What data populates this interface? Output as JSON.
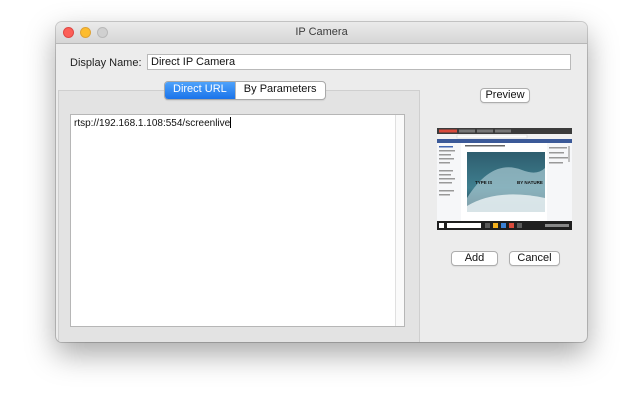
{
  "window": {
    "title": "IP Camera"
  },
  "form": {
    "display_name_label": "Display Name:",
    "display_name_value": "Direct IP Camera"
  },
  "tabs": [
    {
      "label": "Direct URL",
      "selected": true
    },
    {
      "label": "By Parameters",
      "selected": false
    }
  ],
  "url": {
    "value": "rtsp://192.168.1.108:554/screenlive"
  },
  "buttons": {
    "preview": "Preview",
    "add": "Add",
    "cancel": "Cancel"
  },
  "preview": {
    "overlay_left": "TYPE IS",
    "overlay_right": "BY NATURE",
    "icon": "camera-preview-image"
  },
  "colors": {
    "accent": "#1a73ea",
    "close": "#fc5f57",
    "minimize": "#fdbc2e",
    "maximize": "#d0d0d0"
  }
}
